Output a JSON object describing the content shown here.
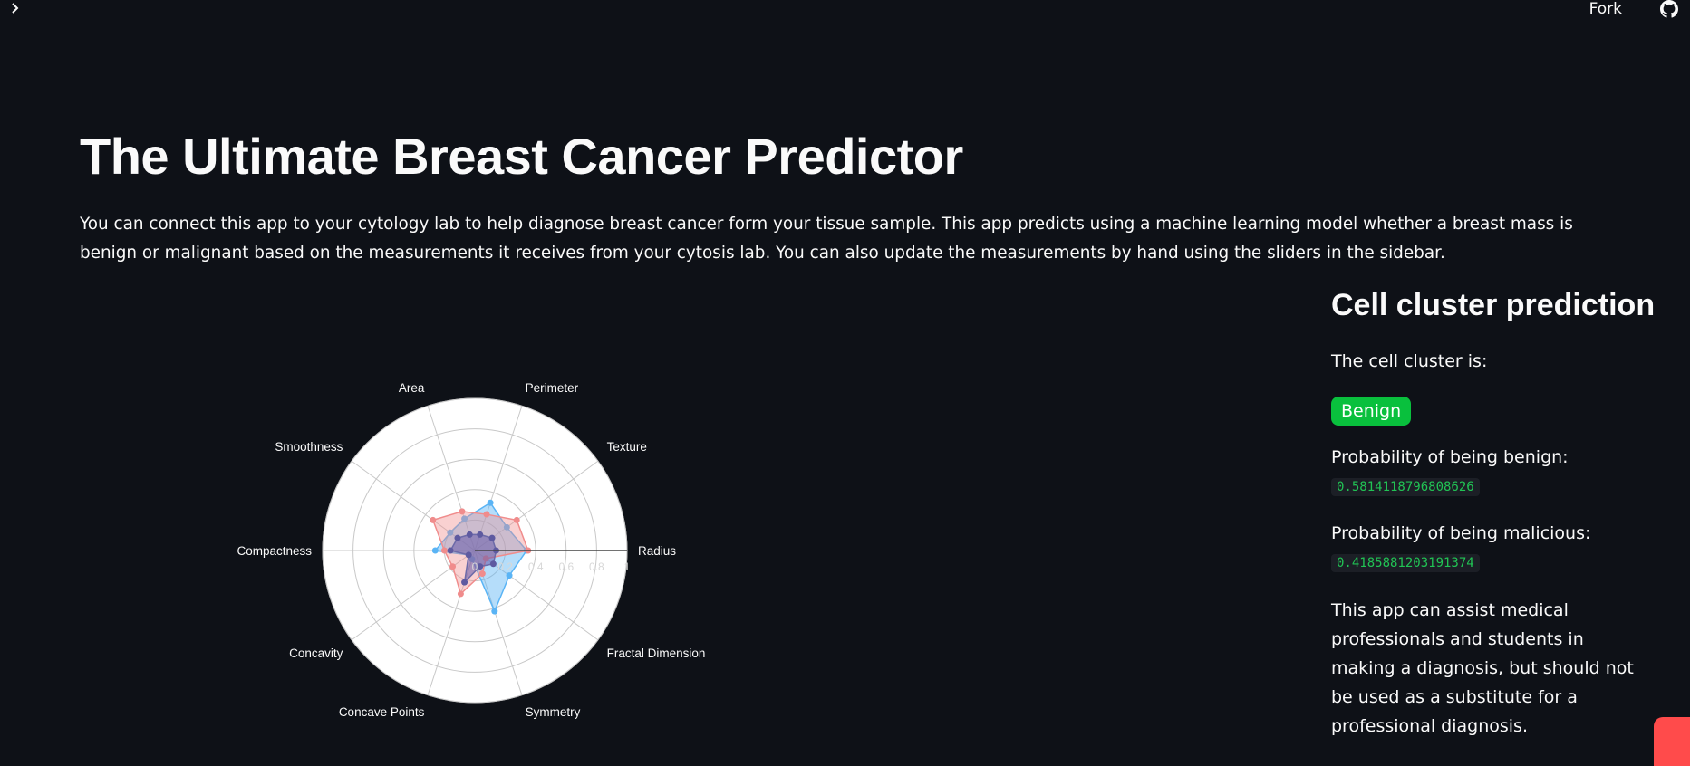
{
  "topbar": {
    "fork_label": "Fork"
  },
  "icons": {
    "sidebar_toggle": "chevron-right-icon",
    "github": "github-icon"
  },
  "header": {
    "title": "The Ultimate Breast Cancer Predictor",
    "intro": "You can connect this app to your cytology lab to help diagnose breast cancer form your tissue sample. This app predicts using a machine learning model whether a breast mass is benign or malignant based on the measurements it receives from your cytosis lab. You can also update the measurements by hand using the sliders in the sidebar."
  },
  "prediction": {
    "heading": "Cell cluster prediction",
    "cluster_label": "The cell cluster is:",
    "result": "Benign",
    "benign_label": "Probability of being benign:",
    "benign_value": "0.5814118796808626",
    "malicious_label": "Probability of being malicious:",
    "malicious_value": "0.4185881203191374",
    "disclaimer": "This app can assist medical professionals and students in making a diagnosis, but should not be used as a substitute for a professional diagnosis."
  },
  "colors": {
    "background": "#0e1117",
    "badge": "#09c03d",
    "code_text": "#21c354",
    "series_blue": "#5ab4f5",
    "series_red": "#f08c8c",
    "accent": "#ff4b4b"
  },
  "chart_data": {
    "type": "radar",
    "categories": [
      "Radius",
      "Texture",
      "Perimeter",
      "Area",
      "Smoothness",
      "Compactness",
      "Concavity",
      "Concave Points",
      "Symmetry",
      "Fractal Dimension"
    ],
    "radial_ticks": [
      "0",
      "0.2",
      "0.4",
      "0.6",
      "0.8",
      "1"
    ],
    "rlim": [
      0,
      1
    ],
    "series": [
      {
        "values": [
          0.34,
          0.26,
          0.33,
          0.22,
          0.2,
          0.26,
          0.05,
          0.06,
          0.42,
          0.28
        ]
      },
      {
        "values": [
          0.35,
          0.34,
          0.25,
          0.27,
          0.34,
          0.2,
          0.18,
          0.3,
          0.16,
          0.09
        ]
      },
      {
        "values": [
          0.14,
          0.14,
          0.11,
          0.11,
          0.14,
          0.16,
          0.05,
          0.22,
          0.11,
          0.15
        ]
      }
    ],
    "grid": true,
    "legend": "none"
  }
}
